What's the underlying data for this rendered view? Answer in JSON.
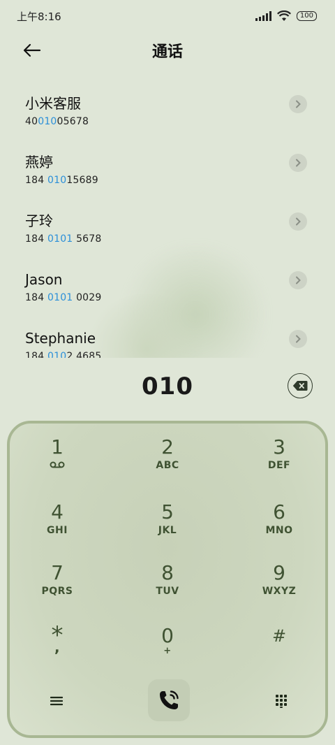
{
  "status_bar": {
    "time": "上午8:16",
    "battery": "100"
  },
  "header": {
    "title": "通话"
  },
  "contacts": [
    {
      "name": "小米客服",
      "num_pre": "40",
      "num_hl": "010",
      "num_post": "05678"
    },
    {
      "name": "燕婷",
      "num_pre": "184 ",
      "num_hl": "010",
      "num_post": "15689"
    },
    {
      "name": "子玲",
      "num_pre": "184 ",
      "num_hl": "0101",
      "num_post": " 5678"
    },
    {
      "name": "Jason",
      "num_pre": "184 ",
      "num_hl": "0101",
      "num_post": " 0029"
    },
    {
      "name": "Stephanie",
      "num_pre": "184 ",
      "num_hl": "010",
      "num_post": "2 4685"
    }
  ],
  "dialer": {
    "dialed": "010"
  },
  "keypad": {
    "keys": [
      {
        "digit": "1",
        "letters": ""
      },
      {
        "digit": "2",
        "letters": "ABC"
      },
      {
        "digit": "3",
        "letters": "DEF"
      },
      {
        "digit": "4",
        "letters": "GHI"
      },
      {
        "digit": "5",
        "letters": "JKL"
      },
      {
        "digit": "6",
        "letters": "MNO"
      },
      {
        "digit": "7",
        "letters": "PQRS"
      },
      {
        "digit": "8",
        "letters": "TUV"
      },
      {
        "digit": "9",
        "letters": "WXYZ"
      },
      {
        "digit": "*",
        "letters": ","
      },
      {
        "digit": "0",
        "letters": "+"
      },
      {
        "digit": "#",
        "letters": ""
      }
    ]
  },
  "colors": {
    "accent": "#2b8fd8",
    "keypad_text": "#3f5232",
    "keypad_border": "#a8b793"
  },
  "icons": {
    "back": "arrow-left-icon",
    "detail": "chevron-right-icon",
    "backspace": "backspace-icon",
    "voicemail": "voicemail-icon",
    "call": "phone-icon",
    "menu": "menu-icon",
    "dialpad": "dialpad-icon"
  }
}
